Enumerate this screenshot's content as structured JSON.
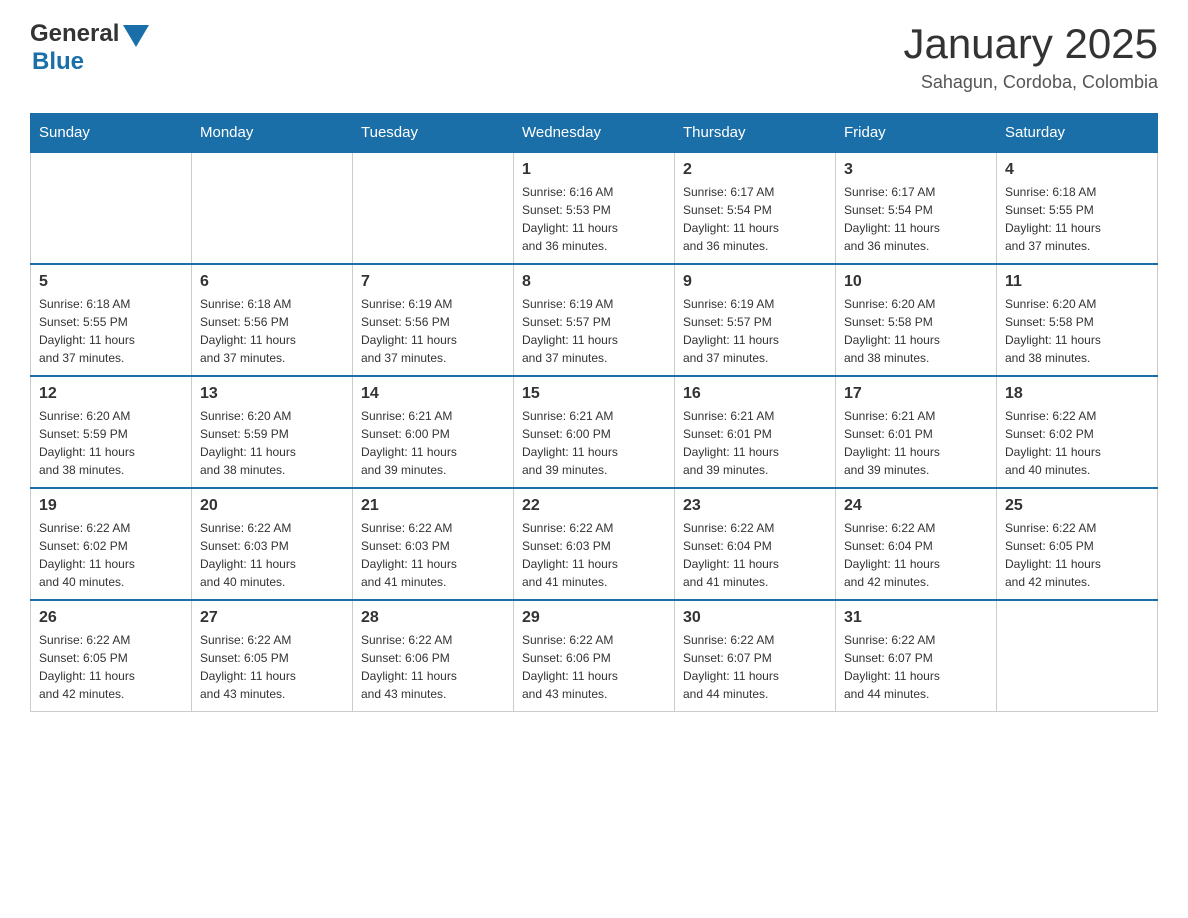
{
  "header": {
    "logo": {
      "general": "General",
      "triangle": "▲",
      "blue": "Blue"
    },
    "title": "January 2025",
    "location": "Sahagun, Cordoba, Colombia"
  },
  "days_of_week": [
    "Sunday",
    "Monday",
    "Tuesday",
    "Wednesday",
    "Thursday",
    "Friday",
    "Saturday"
  ],
  "weeks": [
    [
      {
        "day": "",
        "info": ""
      },
      {
        "day": "",
        "info": ""
      },
      {
        "day": "",
        "info": ""
      },
      {
        "day": "1",
        "info": "Sunrise: 6:16 AM\nSunset: 5:53 PM\nDaylight: 11 hours\nand 36 minutes."
      },
      {
        "day": "2",
        "info": "Sunrise: 6:17 AM\nSunset: 5:54 PM\nDaylight: 11 hours\nand 36 minutes."
      },
      {
        "day": "3",
        "info": "Sunrise: 6:17 AM\nSunset: 5:54 PM\nDaylight: 11 hours\nand 36 minutes."
      },
      {
        "day": "4",
        "info": "Sunrise: 6:18 AM\nSunset: 5:55 PM\nDaylight: 11 hours\nand 37 minutes."
      }
    ],
    [
      {
        "day": "5",
        "info": "Sunrise: 6:18 AM\nSunset: 5:55 PM\nDaylight: 11 hours\nand 37 minutes."
      },
      {
        "day": "6",
        "info": "Sunrise: 6:18 AM\nSunset: 5:56 PM\nDaylight: 11 hours\nand 37 minutes."
      },
      {
        "day": "7",
        "info": "Sunrise: 6:19 AM\nSunset: 5:56 PM\nDaylight: 11 hours\nand 37 minutes."
      },
      {
        "day": "8",
        "info": "Sunrise: 6:19 AM\nSunset: 5:57 PM\nDaylight: 11 hours\nand 37 minutes."
      },
      {
        "day": "9",
        "info": "Sunrise: 6:19 AM\nSunset: 5:57 PM\nDaylight: 11 hours\nand 37 minutes."
      },
      {
        "day": "10",
        "info": "Sunrise: 6:20 AM\nSunset: 5:58 PM\nDaylight: 11 hours\nand 38 minutes."
      },
      {
        "day": "11",
        "info": "Sunrise: 6:20 AM\nSunset: 5:58 PM\nDaylight: 11 hours\nand 38 minutes."
      }
    ],
    [
      {
        "day": "12",
        "info": "Sunrise: 6:20 AM\nSunset: 5:59 PM\nDaylight: 11 hours\nand 38 minutes."
      },
      {
        "day": "13",
        "info": "Sunrise: 6:20 AM\nSunset: 5:59 PM\nDaylight: 11 hours\nand 38 minutes."
      },
      {
        "day": "14",
        "info": "Sunrise: 6:21 AM\nSunset: 6:00 PM\nDaylight: 11 hours\nand 39 minutes."
      },
      {
        "day": "15",
        "info": "Sunrise: 6:21 AM\nSunset: 6:00 PM\nDaylight: 11 hours\nand 39 minutes."
      },
      {
        "day": "16",
        "info": "Sunrise: 6:21 AM\nSunset: 6:01 PM\nDaylight: 11 hours\nand 39 minutes."
      },
      {
        "day": "17",
        "info": "Sunrise: 6:21 AM\nSunset: 6:01 PM\nDaylight: 11 hours\nand 39 minutes."
      },
      {
        "day": "18",
        "info": "Sunrise: 6:22 AM\nSunset: 6:02 PM\nDaylight: 11 hours\nand 40 minutes."
      }
    ],
    [
      {
        "day": "19",
        "info": "Sunrise: 6:22 AM\nSunset: 6:02 PM\nDaylight: 11 hours\nand 40 minutes."
      },
      {
        "day": "20",
        "info": "Sunrise: 6:22 AM\nSunset: 6:03 PM\nDaylight: 11 hours\nand 40 minutes."
      },
      {
        "day": "21",
        "info": "Sunrise: 6:22 AM\nSunset: 6:03 PM\nDaylight: 11 hours\nand 41 minutes."
      },
      {
        "day": "22",
        "info": "Sunrise: 6:22 AM\nSunset: 6:03 PM\nDaylight: 11 hours\nand 41 minutes."
      },
      {
        "day": "23",
        "info": "Sunrise: 6:22 AM\nSunset: 6:04 PM\nDaylight: 11 hours\nand 41 minutes."
      },
      {
        "day": "24",
        "info": "Sunrise: 6:22 AM\nSunset: 6:04 PM\nDaylight: 11 hours\nand 42 minutes."
      },
      {
        "day": "25",
        "info": "Sunrise: 6:22 AM\nSunset: 6:05 PM\nDaylight: 11 hours\nand 42 minutes."
      }
    ],
    [
      {
        "day": "26",
        "info": "Sunrise: 6:22 AM\nSunset: 6:05 PM\nDaylight: 11 hours\nand 42 minutes."
      },
      {
        "day": "27",
        "info": "Sunrise: 6:22 AM\nSunset: 6:05 PM\nDaylight: 11 hours\nand 43 minutes."
      },
      {
        "day": "28",
        "info": "Sunrise: 6:22 AM\nSunset: 6:06 PM\nDaylight: 11 hours\nand 43 minutes."
      },
      {
        "day": "29",
        "info": "Sunrise: 6:22 AM\nSunset: 6:06 PM\nDaylight: 11 hours\nand 43 minutes."
      },
      {
        "day": "30",
        "info": "Sunrise: 6:22 AM\nSunset: 6:07 PM\nDaylight: 11 hours\nand 44 minutes."
      },
      {
        "day": "31",
        "info": "Sunrise: 6:22 AM\nSunset: 6:07 PM\nDaylight: 11 hours\nand 44 minutes."
      },
      {
        "day": "",
        "info": ""
      }
    ]
  ]
}
